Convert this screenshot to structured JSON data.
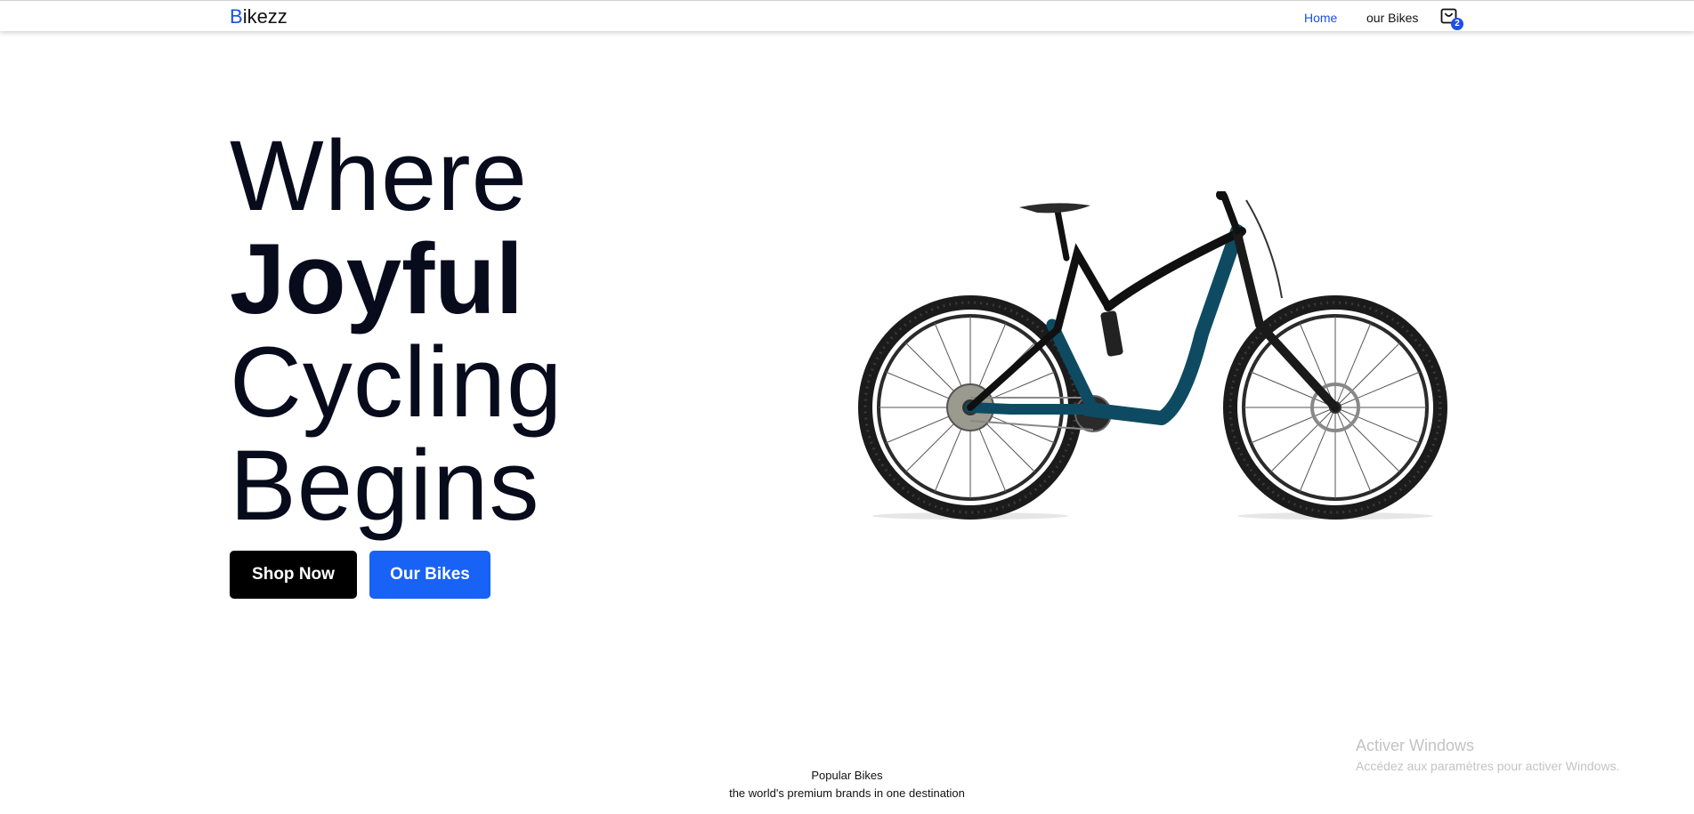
{
  "nav": {
    "brand_first": "B",
    "brand_rest": "ikezz",
    "links": [
      "Home",
      "our Bikes"
    ],
    "cart_count": "2",
    "cart_icon": "cart-icon"
  },
  "hero": {
    "line1": "Where",
    "line2": "Joyful",
    "line3": "Cycling",
    "line4": "Begins",
    "shop_label": "Shop Now",
    "bikes_label": "Our Bikes",
    "image": "mountain-bike-image"
  },
  "popular": {
    "title": "Popular Bikes",
    "subtitle": "the world's premium brands in one destination"
  },
  "watermark": {
    "title": "Activer Windows",
    "subtitle": "Accédez aux paramètres pour activer Windows."
  },
  "colors": {
    "accent": "#1a4fe8",
    "button_blue": "#1862f5",
    "button_black": "#000000",
    "text_dark": "#070b1c",
    "bike_frame": "#0e4b63"
  }
}
